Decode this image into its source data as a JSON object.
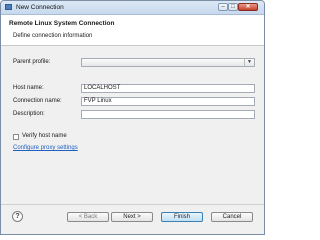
{
  "window": {
    "title": "New Connection",
    "controls": {
      "minimize": "–",
      "maximize": "□",
      "close": "✕"
    }
  },
  "header": {
    "title": "Remote Linux System Connection",
    "description": "Define connection information"
  },
  "form": {
    "parent_profile": {
      "label": "Parent profile:",
      "value": ""
    },
    "host_name": {
      "label": "Host name:",
      "value": "LOCALHOST"
    },
    "connection_name": {
      "label": "Connection name:",
      "value": "FVP Linux"
    },
    "description": {
      "label": "Description:",
      "value": ""
    },
    "verify_host": {
      "label": "Verify host name",
      "checked": false
    },
    "proxy_link": "Configure proxy settings"
  },
  "footer": {
    "help": "?",
    "back": "< Back",
    "next": "Next >",
    "finish": "Finish",
    "cancel": "Cancel"
  },
  "icons": {
    "combo_arrow": "chevron-down-icon",
    "help": "help-icon"
  }
}
